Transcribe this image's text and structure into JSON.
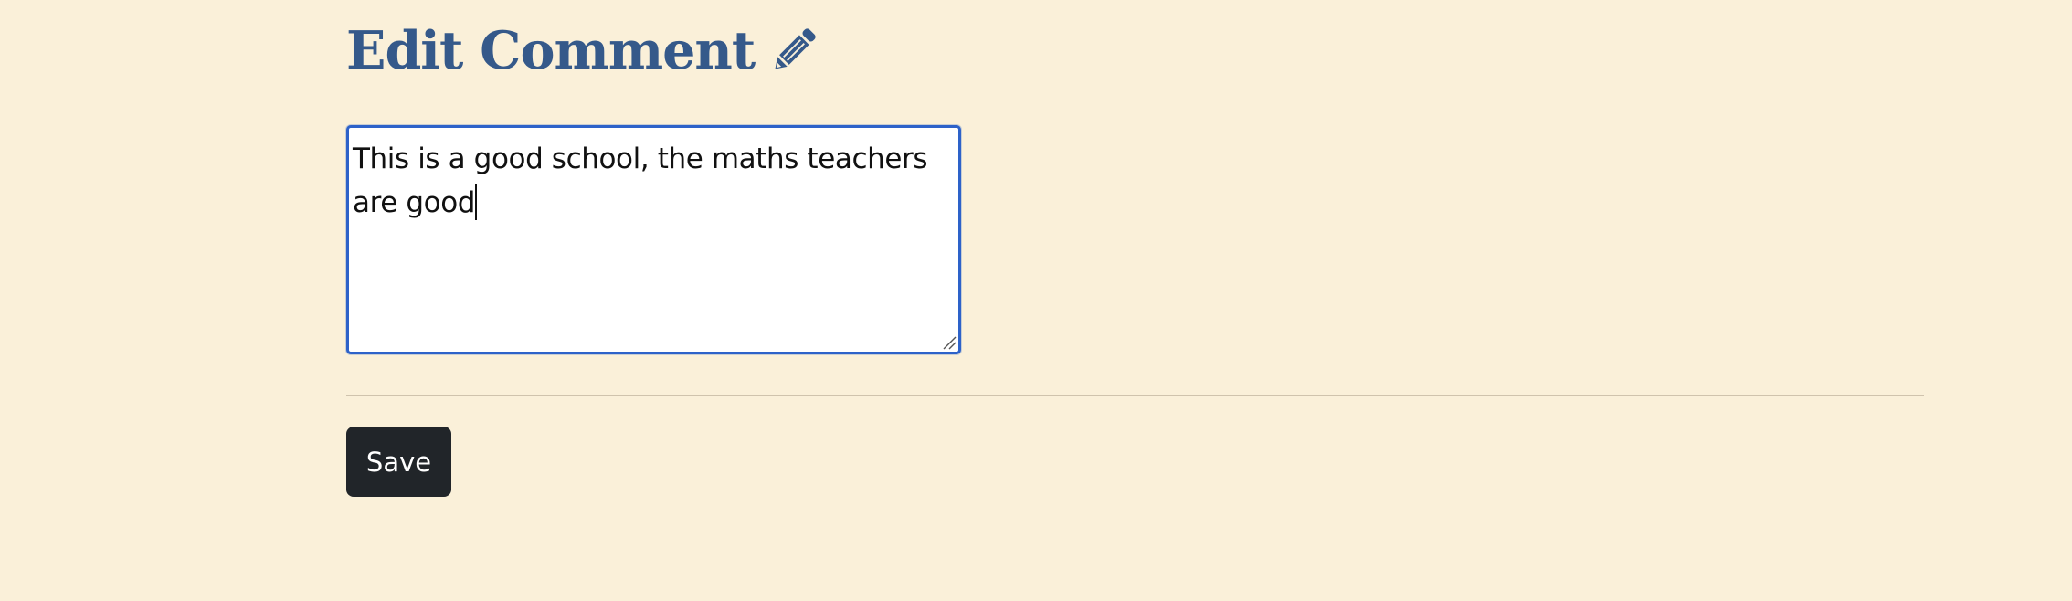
{
  "page": {
    "title": "Edit Comment",
    "title_icon": "pencil-icon"
  },
  "form": {
    "comment_value": "This is a good school, the maths teachers are good",
    "save_label": "Save"
  },
  "colors": {
    "background": "#faf0d9",
    "title": "#35598a",
    "input_border_focus": "#2d62c9",
    "button_bg": "#212529",
    "button_text": "#ffffff"
  }
}
